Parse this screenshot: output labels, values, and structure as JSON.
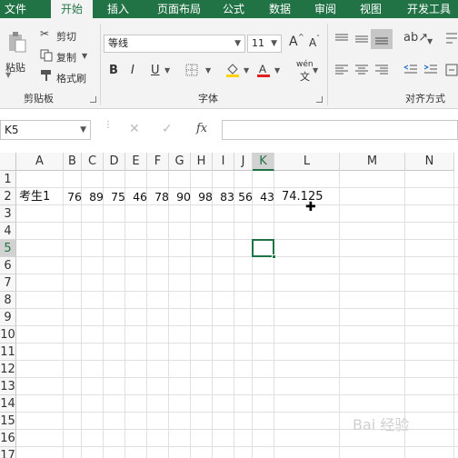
{
  "tabs": [
    "文件",
    "开始",
    "插入",
    "页面布局",
    "公式",
    "数据",
    "审阅",
    "视图",
    "开发工具"
  ],
  "clipboard": {
    "paste": "粘贴",
    "cut": "剪切",
    "copy": "复制",
    "format_painter": "格式刷",
    "group_label": "剪贴板"
  },
  "font": {
    "name": "等线",
    "size": "11",
    "bold": "B",
    "italic": "I",
    "underline": "U",
    "grow": "A",
    "shrink": "A",
    "phonetic": "wén",
    "group_label": "字体"
  },
  "alignment": {
    "group_label": "对齐方式"
  },
  "formula_bar": {
    "name_box": "K5",
    "cancel": "✕",
    "enter": "✓",
    "fx": "fx",
    "value": ""
  },
  "columns": [
    "A",
    "B",
    "C",
    "D",
    "E",
    "F",
    "G",
    "H",
    "I",
    "J",
    "K",
    "L",
    "M",
    "N"
  ],
  "rows": [
    "1",
    "2",
    "3",
    "4",
    "5",
    "6",
    "7",
    "8",
    "9",
    "10",
    "11",
    "12",
    "13",
    "14",
    "15",
    "16",
    "17"
  ],
  "row2": {
    "A": "考生1",
    "B": "76",
    "C": "89",
    "D": "75",
    "E": "46",
    "F": "78",
    "G": "90",
    "H": "98",
    "I": "83",
    "J": "56",
    "K": "43",
    "L": "74.125"
  },
  "watermark": "Bai 经验",
  "colors": {
    "accent": "#217346",
    "grid_line": "#e0e0e0",
    "font_color_bar": "#e02020",
    "fill_color_bar": "#ffd200"
  }
}
